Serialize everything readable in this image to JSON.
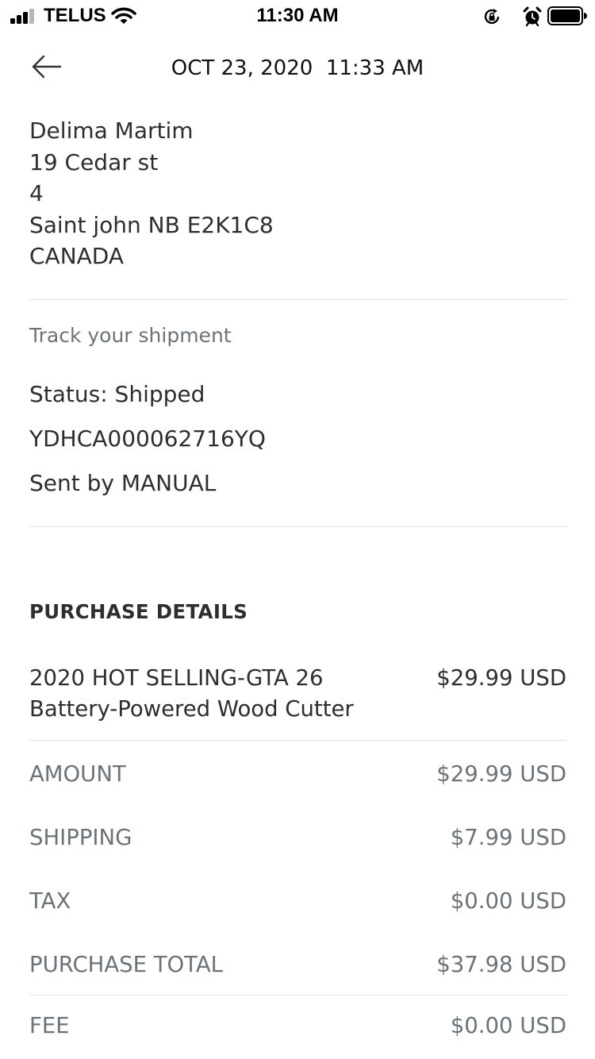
{
  "status_bar": {
    "carrier": "TELUS",
    "time": "11:30 AM"
  },
  "header": {
    "date_time": "OCT 23, 2020  11:33 AM"
  },
  "address": {
    "name": "Delima Martim",
    "street": "19 Cedar st",
    "unit": "4",
    "city_line": "Saint john NB E2K1C8",
    "country": "CANADA"
  },
  "tracking": {
    "link_label": "Track your shipment",
    "status": "Status: Shipped",
    "tracking_number": "YDHCA000062716YQ",
    "sent_by": "Sent by MANUAL"
  },
  "purchase": {
    "section_title": "PURCHASE DETAILS",
    "item": {
      "name_line1": "2020 HOT SELLING-GTA 26",
      "name_line2": "Battery-Powered Wood Cutter",
      "price": "$29.99 USD"
    },
    "summary": [
      {
        "label": "AMOUNT",
        "value": "$29.99 USD"
      },
      {
        "label": "SHIPPING",
        "value": "$7.99 USD"
      },
      {
        "label": "TAX",
        "value": "$0.00 USD"
      },
      {
        "label": "PURCHASE TOTAL",
        "value": "$37.98 USD"
      },
      {
        "label": "FEE",
        "value": "$0.00 USD"
      }
    ]
  }
}
